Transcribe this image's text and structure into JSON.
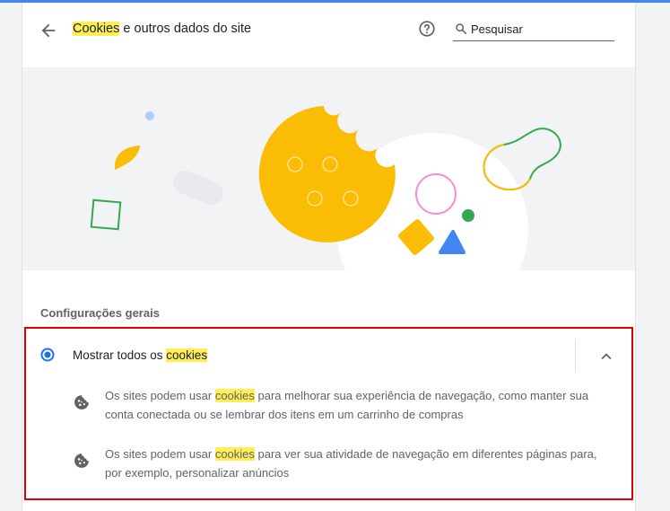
{
  "header": {
    "title_highlight": "Cookies",
    "title_rest": " e outros dados do site",
    "search_placeholder": "Pesquisar"
  },
  "section": {
    "title": "Configurações gerais"
  },
  "option": {
    "label_prefix": "Mostrar todos os ",
    "label_highlight": "cookies",
    "selected": true,
    "expanded": true,
    "descriptions": [
      {
        "prefix": "Os sites podem usar ",
        "highlight": "cookies",
        "suffix": " para melhorar sua experiência de navegação, como manter sua conta conectada ou se lembrar dos itens em um carrinho de compras"
      },
      {
        "prefix": "Os sites podem usar ",
        "highlight": "cookies",
        "suffix": " para ver sua atividade de navegação em diferentes páginas para, por exemplo, personalizar anúncios"
      }
    ]
  },
  "icons": {
    "back": "arrow-back-icon",
    "help": "help-circle-icon",
    "search": "search-icon",
    "expand": "chevron-up-icon",
    "description": "cookie-icon"
  },
  "colors": {
    "accent": "#1a73e8",
    "highlight": "#ffee55",
    "focus_border": "#e00000",
    "cookie_yellow": "#fbbc04",
    "green": "#34a853",
    "blue": "#4285f4",
    "pink": "#f48fdb"
  }
}
